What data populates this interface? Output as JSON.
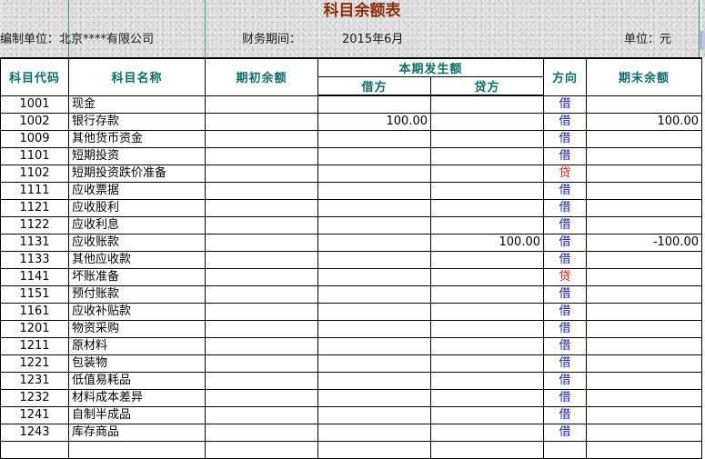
{
  "report": {
    "title": "科目余额表",
    "org_label": "编制单位：北京****有限公司",
    "period_label": "财务期间：",
    "period_value": "2015年6月",
    "unit_label": "单位：元"
  },
  "columns": {
    "code": "科目代码",
    "name": "科目名称",
    "opening": "期初余额",
    "current": "本期发生额",
    "debit": "借方",
    "credit": "贷方",
    "direction": "方向",
    "closing": "期末余额"
  },
  "colors": {
    "title": "#8b2d08",
    "header_text": "#0f6a6a",
    "blue_text": "#1a24a3",
    "red_text": "#e01010"
  },
  "rows": [
    {
      "code": "1001",
      "name": "现金",
      "opening": "",
      "debit": "",
      "credit": "",
      "direction": "借",
      "closing": ""
    },
    {
      "code": "1002",
      "name": "银行存款",
      "opening": "",
      "debit": "100.00",
      "credit": "",
      "direction": "借",
      "closing": "100.00"
    },
    {
      "code": "1009",
      "name": "其他货币资金",
      "opening": "",
      "debit": "",
      "credit": "",
      "direction": "借",
      "closing": ""
    },
    {
      "code": "1101",
      "name": "短期投资",
      "opening": "",
      "debit": "",
      "credit": "",
      "direction": "借",
      "closing": ""
    },
    {
      "code": "1102",
      "name": "短期投资跌价准备",
      "opening": "",
      "debit": "",
      "credit": "",
      "direction": "贷",
      "closing": ""
    },
    {
      "code": "1111",
      "name": "应收票据",
      "opening": "",
      "debit": "",
      "credit": "",
      "direction": "借",
      "closing": ""
    },
    {
      "code": "1121",
      "name": "应收股利",
      "opening": "",
      "debit": "",
      "credit": "",
      "direction": "借",
      "closing": ""
    },
    {
      "code": "1122",
      "name": "应收利息",
      "opening": "",
      "debit": "",
      "credit": "",
      "direction": "借",
      "closing": ""
    },
    {
      "code": "1131",
      "name": "应收账款",
      "opening": "",
      "debit": "",
      "credit": "100.00",
      "direction": "借",
      "closing": "-100.00"
    },
    {
      "code": "1133",
      "name": "其他应收款",
      "opening": "",
      "debit": "",
      "credit": "",
      "direction": "借",
      "closing": ""
    },
    {
      "code": "1141",
      "name": "坏账准备",
      "opening": "",
      "debit": "",
      "credit": "",
      "direction": "贷",
      "closing": ""
    },
    {
      "code": "1151",
      "name": "预付账款",
      "opening": "",
      "debit": "",
      "credit": "",
      "direction": "借",
      "closing": ""
    },
    {
      "code": "1161",
      "name": "应收补贴款",
      "opening": "",
      "debit": "",
      "credit": "",
      "direction": "借",
      "closing": ""
    },
    {
      "code": "1201",
      "name": "物资采购",
      "opening": "",
      "debit": "",
      "credit": "",
      "direction": "借",
      "closing": ""
    },
    {
      "code": "1211",
      "name": "原材料",
      "opening": "",
      "debit": "",
      "credit": "",
      "direction": "借",
      "closing": ""
    },
    {
      "code": "1221",
      "name": "包装物",
      "opening": "",
      "debit": "",
      "credit": "",
      "direction": "借",
      "closing": ""
    },
    {
      "code": "1231",
      "name": "低值易耗品",
      "opening": "",
      "debit": "",
      "credit": "",
      "direction": "借",
      "closing": ""
    },
    {
      "code": "1232",
      "name": "材料成本差异",
      "opening": "",
      "debit": "",
      "credit": "",
      "direction": "借",
      "closing": ""
    },
    {
      "code": "1241",
      "name": "自制半成品",
      "opening": "",
      "debit": "",
      "credit": "",
      "direction": "借",
      "closing": ""
    },
    {
      "code": "1243",
      "name": "库存商品",
      "opening": "",
      "debit": "",
      "credit": "",
      "direction": "借",
      "closing": ""
    },
    {
      "code": "",
      "name": "",
      "opening": "",
      "debit": "",
      "credit": "",
      "direction": "",
      "closing": ""
    }
  ]
}
